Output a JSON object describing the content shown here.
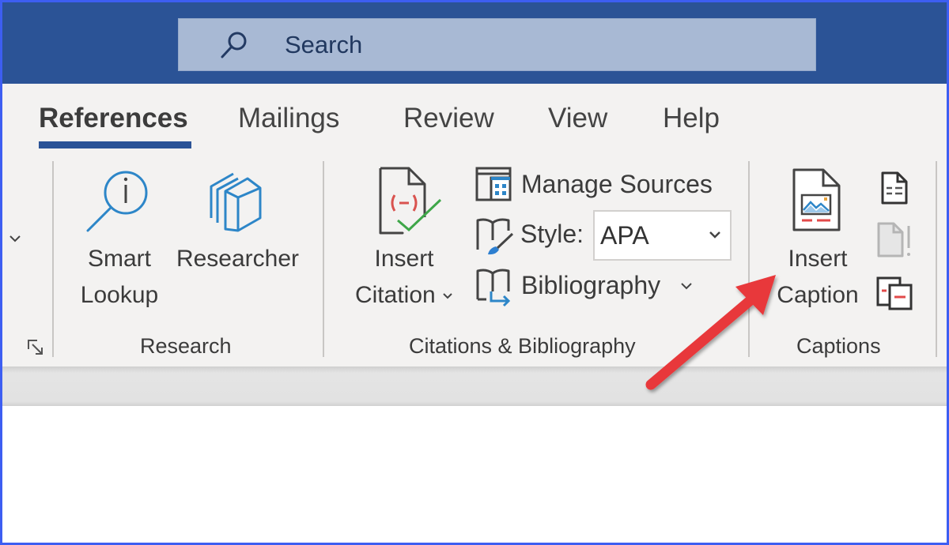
{
  "titlebar": {
    "search": {
      "placeholder": "Search",
      "icon": "search-icon"
    }
  },
  "tabs": [
    {
      "label": "References",
      "active": true
    },
    {
      "label": "Mailings",
      "active": false
    },
    {
      "label": "Review",
      "active": false
    },
    {
      "label": "View",
      "active": false
    },
    {
      "label": "Help",
      "active": false
    }
  ],
  "ribbon": {
    "research": {
      "group_label": "Research",
      "smart_lookup": {
        "line1": "Smart",
        "line2": "Lookup",
        "icon": "smart-lookup-icon"
      },
      "researcher": {
        "label": "Researcher",
        "icon": "researcher-icon"
      }
    },
    "citations": {
      "group_label": "Citations & Bibliography",
      "insert_citation": {
        "line1": "Insert",
        "line2": "Citation",
        "icon": "insert-citation-icon"
      },
      "manage_sources": {
        "label": "Manage Sources",
        "icon": "manage-sources-icon"
      },
      "style": {
        "label": "Style:",
        "value": "APA",
        "icon": "style-icon"
      },
      "bibliography": {
        "label": "Bibliography",
        "icon": "bibliography-icon"
      }
    },
    "captions": {
      "group_label": "Captions",
      "insert_caption": {
        "line1": "Insert",
        "line2": "Caption",
        "icon": "insert-caption-icon"
      },
      "small_icons": [
        "insert-table-of-figures-icon",
        "update-table-icon",
        "cross-reference-icon"
      ]
    }
  },
  "annotation": {
    "type": "arrow",
    "color": "#e8393a",
    "points_to": "Insert Caption"
  },
  "colors": {
    "titlebar": "#2b5396",
    "search_box": "#a8b9d4",
    "accent": "#2b5396",
    "frame_border": "#3d5ef2"
  }
}
